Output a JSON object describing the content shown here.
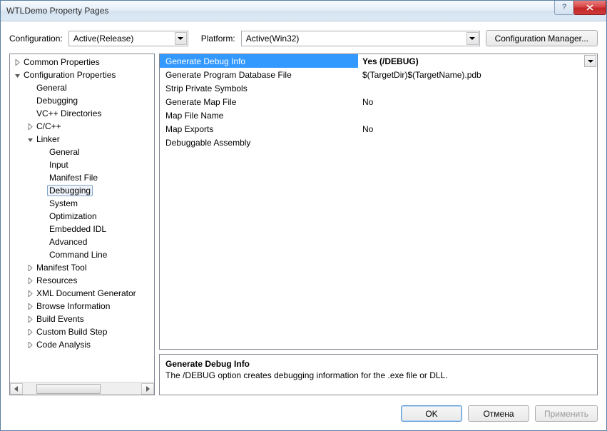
{
  "window": {
    "title": "WTLDemo Property Pages"
  },
  "toolbar": {
    "config_label": "Configuration:",
    "config_value": "Active(Release)",
    "platform_label": "Platform:",
    "platform_value": "Active(Win32)",
    "manager_btn": "Configuration Manager..."
  },
  "tree": {
    "items": [
      {
        "depth": 0,
        "arrow": "closed",
        "label": "Common Properties"
      },
      {
        "depth": 0,
        "arrow": "open",
        "label": "Configuration Properties"
      },
      {
        "depth": 1,
        "arrow": "none",
        "label": "General"
      },
      {
        "depth": 1,
        "arrow": "none",
        "label": "Debugging"
      },
      {
        "depth": 1,
        "arrow": "none",
        "label": "VC++ Directories"
      },
      {
        "depth": 1,
        "arrow": "closed",
        "label": "C/C++"
      },
      {
        "depth": 1,
        "arrow": "open",
        "label": "Linker"
      },
      {
        "depth": 2,
        "arrow": "none",
        "label": "General"
      },
      {
        "depth": 2,
        "arrow": "none",
        "label": "Input"
      },
      {
        "depth": 2,
        "arrow": "none",
        "label": "Manifest File"
      },
      {
        "depth": 2,
        "arrow": "none",
        "label": "Debugging",
        "selected": true
      },
      {
        "depth": 2,
        "arrow": "none",
        "label": "System"
      },
      {
        "depth": 2,
        "arrow": "none",
        "label": "Optimization"
      },
      {
        "depth": 2,
        "arrow": "none",
        "label": "Embedded IDL"
      },
      {
        "depth": 2,
        "arrow": "none",
        "label": "Advanced"
      },
      {
        "depth": 2,
        "arrow": "none",
        "label": "Command Line"
      },
      {
        "depth": 1,
        "arrow": "closed",
        "label": "Manifest Tool"
      },
      {
        "depth": 1,
        "arrow": "closed",
        "label": "Resources"
      },
      {
        "depth": 1,
        "arrow": "closed",
        "label": "XML Document Generator"
      },
      {
        "depth": 1,
        "arrow": "closed",
        "label": "Browse Information"
      },
      {
        "depth": 1,
        "arrow": "closed",
        "label": "Build Events"
      },
      {
        "depth": 1,
        "arrow": "closed",
        "label": "Custom Build Step"
      },
      {
        "depth": 1,
        "arrow": "closed",
        "label": "Code Analysis"
      }
    ]
  },
  "grid": {
    "rows": [
      {
        "name": "Generate Debug Info",
        "value": "Yes (/DEBUG)",
        "selected": true
      },
      {
        "name": "Generate Program Database File",
        "value": "$(TargetDir)$(TargetName).pdb"
      },
      {
        "name": "Strip Private Symbols",
        "value": ""
      },
      {
        "name": "Generate Map File",
        "value": "No"
      },
      {
        "name": "Map File Name",
        "value": ""
      },
      {
        "name": "Map Exports",
        "value": "No"
      },
      {
        "name": "Debuggable Assembly",
        "value": ""
      }
    ]
  },
  "description": {
    "title": "Generate Debug Info",
    "text": "The /DEBUG option creates debugging information for the .exe file or DLL."
  },
  "footer": {
    "ok": "OK",
    "cancel": "Отмена",
    "apply": "Применить"
  }
}
